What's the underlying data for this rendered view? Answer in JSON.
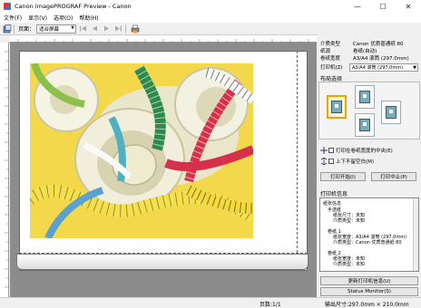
{
  "window": {
    "title": "Canon imagePROGRAF Preview - Canon",
    "controls": {
      "minimize": "—",
      "maximize": "☐",
      "close": "✕"
    }
  },
  "menu": [
    "文件(F)",
    "显示(V)",
    "选项(O)",
    "帮助(H)"
  ],
  "toolbar": {
    "zoom_label": "页面：",
    "zoom_value": "适合屏幕"
  },
  "panel": {
    "media_type_label": "介质类型",
    "media_type_value": "Canon 优质普通纸 80",
    "roll_label": "纸源",
    "roll_value": "卷纸(自动)",
    "roll_width_label": "卷纸宽度",
    "roll_width_value": "A3/A4 滚筒 (297.0mm)",
    "printer_label": "打印机(Z)",
    "printer_value": "A3/A4 滚筒 (297.0mm)",
    "layout_title": "布局选择",
    "check_center": "打印在卷纸宽度的中央(E)",
    "check_no_margin": "上下不留空白(M)",
    "start_button": "打印开始(I)",
    "cancel_button": "打印中止(P)",
    "info_title": "打印机信息",
    "info_lines": [
      "纸张信息",
      "手送纸",
      "纸张尺寸：未知",
      "介质类型：未知",
      "卷纸 1",
      "纸张宽度：A3/A4 滚筒 (297.0mm)",
      "介质类型：Canon 优质普通纸 80",
      "卷纸 2",
      "纸张宽度：未知",
      "介质类型：未知"
    ],
    "update_button": "更新打印机信息(U)",
    "status_button": "Status Monitor(S)"
  },
  "status": {
    "page": "页数:1/1",
    "output_size": "输出尺寸:297.0mm × 210.0mm"
  },
  "colors": {
    "background": "#f0f0f0",
    "canvas": "#8c8c8c",
    "selection": "#e8a400",
    "margin_line": "#e23333"
  }
}
